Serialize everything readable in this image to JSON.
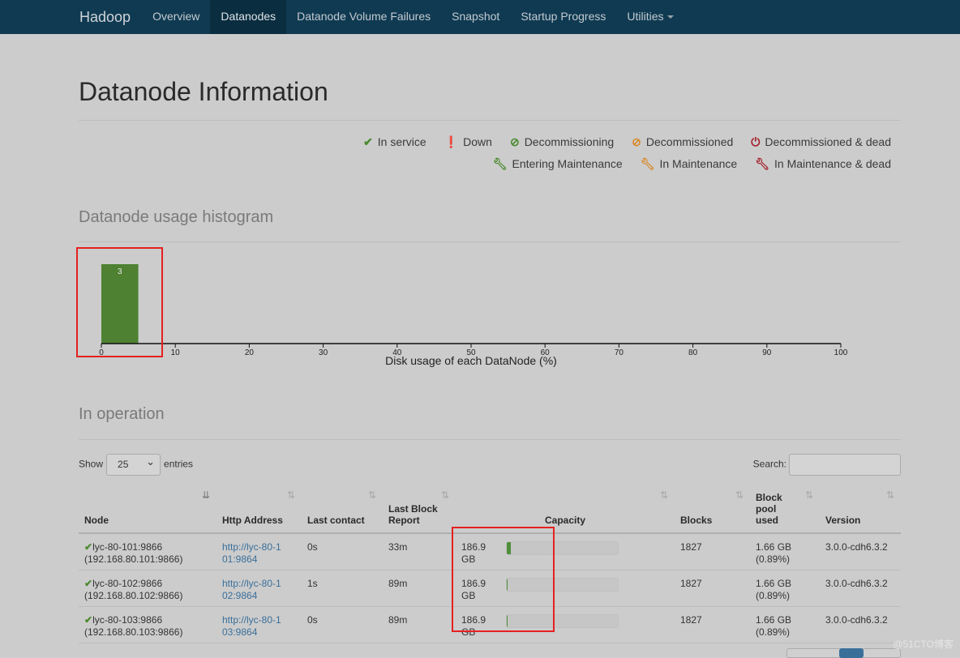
{
  "navbar": {
    "brand": "Hadoop",
    "items": [
      "Overview",
      "Datanodes",
      "Datanode Volume Failures",
      "Snapshot",
      "Startup Progress",
      "Utilities"
    ],
    "active": "Datanodes",
    "color": "#0f3a52"
  },
  "page_title": "Datanode Information",
  "legend": [
    {
      "icon": "check-icon",
      "label": "In service",
      "color": "#4a8a2f"
    },
    {
      "icon": "exclamation-circle-icon",
      "label": "Down",
      "color": "#a4202c"
    },
    {
      "icon": "ban-icon",
      "label": "Decommissioning",
      "color": "#4a8a2f"
    },
    {
      "icon": "ban-icon",
      "label": "Decommissioned",
      "color": "#d98a2a"
    },
    {
      "icon": "power-icon",
      "label": "Decommissioned & dead",
      "color": "#a4202c"
    },
    {
      "icon": "wrench-icon",
      "label": "Entering Maintenance",
      "color": "#4a8a2f"
    },
    {
      "icon": "wrench-icon",
      "label": "In Maintenance",
      "color": "#d98a2a"
    },
    {
      "icon": "wrench-icon",
      "label": "In Maintenance & dead",
      "color": "#a4202c"
    }
  ],
  "histogram_heading": "Datanode usage histogram",
  "chart_data": {
    "type": "bar",
    "xlabel": "Disk usage of each DataNode (%)",
    "xlim": [
      0,
      100
    ],
    "xticks": [
      0,
      10,
      20,
      30,
      40,
      50,
      60,
      70,
      80,
      90,
      100
    ],
    "bins": [
      {
        "x0": 0,
        "x1": 5,
        "count": 3
      }
    ],
    "color": "#4e8232"
  },
  "operation_heading": "In operation",
  "controls": {
    "show": "Show",
    "entries_value": "25",
    "entries": "entries",
    "search": "Search:"
  },
  "table": {
    "columns": [
      "Node",
      "Http Address",
      "Last contact",
      "Last Block Report",
      "Capacity",
      "Blocks",
      "Block pool used",
      "Version"
    ],
    "rows": [
      {
        "node": "lyc-80-101:9866",
        "ip": "(192.168.80.101:9866)",
        "http": "http://lyc-80-101:9864",
        "contact": "0s",
        "report": "33m",
        "capacity": "186.9 GB",
        "used_pct": 4,
        "blocks": "1827",
        "pool": "1.66 GB",
        "pool_pct": "(0.89%)",
        "version": "3.0.0-cdh6.3.2"
      },
      {
        "node": "lyc-80-102:9866",
        "ip": "(192.168.80.102:9866)",
        "http": "http://lyc-80-102:9864",
        "contact": "1s",
        "report": "89m",
        "capacity": "186.9 GB",
        "used_pct": 1,
        "blocks": "1827",
        "pool": "1.66 GB",
        "pool_pct": "(0.89%)",
        "version": "3.0.0-cdh6.3.2"
      },
      {
        "node": "lyc-80-103:9866",
        "ip": "(192.168.80.103:9866)",
        "http": "http://lyc-80-103:9864",
        "contact": "0s",
        "report": "89m",
        "capacity": "186.9 GB",
        "used_pct": 1,
        "blocks": "1827",
        "pool": "1.66 GB",
        "pool_pct": "(0.89%)",
        "version": "3.0.0-cdh6.3.2"
      }
    ]
  },
  "watermark": "@51CTO博客"
}
